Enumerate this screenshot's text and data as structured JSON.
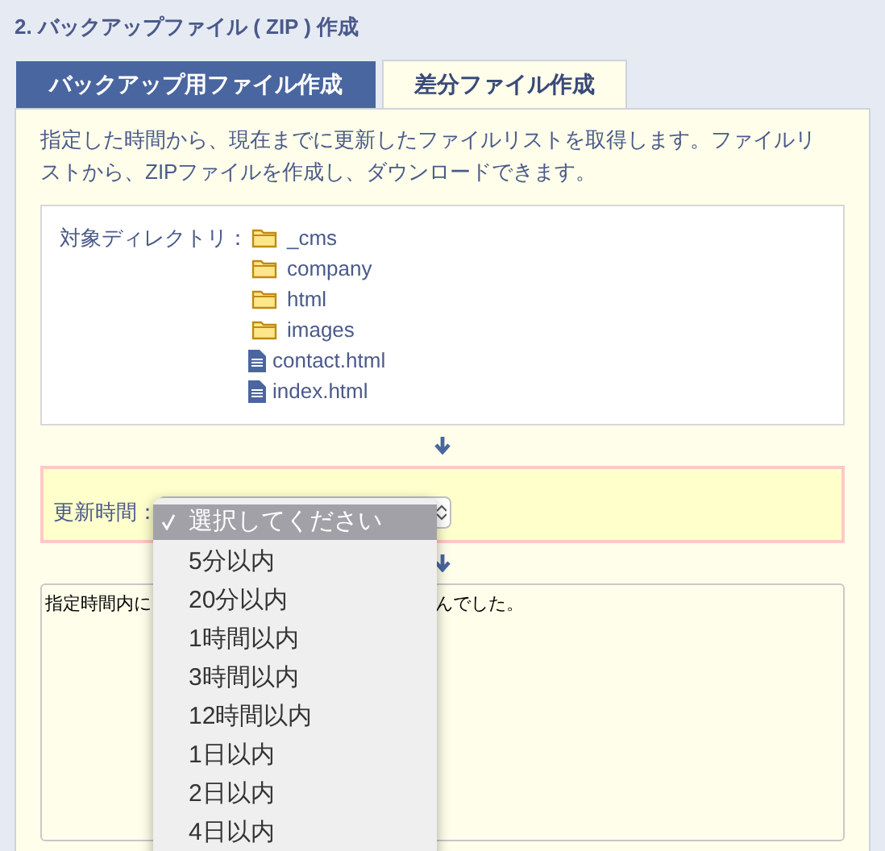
{
  "section_title": "2. バックアップファイル ( ZIP ) 作成",
  "tabs": [
    {
      "label": "バックアップ用ファイル作成",
      "selected": false
    },
    {
      "label": "差分ファイル作成",
      "selected": true
    }
  ],
  "description": "指定した時間から、現在までに更新したファイルリストを取得します。ファイルリストから、ZIPファイルを作成し、ダウンロードできます。",
  "directory": {
    "label": "対象ディレクトリ：",
    "entries": [
      {
        "kind": "folder",
        "name": "_cms"
      },
      {
        "kind": "folder",
        "name": "company"
      },
      {
        "kind": "folder",
        "name": "html"
      },
      {
        "kind": "folder",
        "name": "images"
      },
      {
        "kind": "file",
        "name": "contact.html"
      },
      {
        "kind": "file",
        "name": "index.html"
      }
    ]
  },
  "update_time": {
    "label": "更新時間：",
    "options": [
      {
        "label": "選択してください",
        "selected": true
      },
      {
        "label": "5分以内",
        "selected": false
      },
      {
        "label": "20分以内",
        "selected": false
      },
      {
        "label": "1時間以内",
        "selected": false
      },
      {
        "label": "3時間以内",
        "selected": false
      },
      {
        "label": "12時間以内",
        "selected": false
      },
      {
        "label": "1日以内",
        "selected": false
      },
      {
        "label": "2日以内",
        "selected": false
      },
      {
        "label": "4日以内",
        "selected": false
      }
    ]
  },
  "result": {
    "text_start": "指定時間内に",
    "text_end": "んでした。"
  }
}
